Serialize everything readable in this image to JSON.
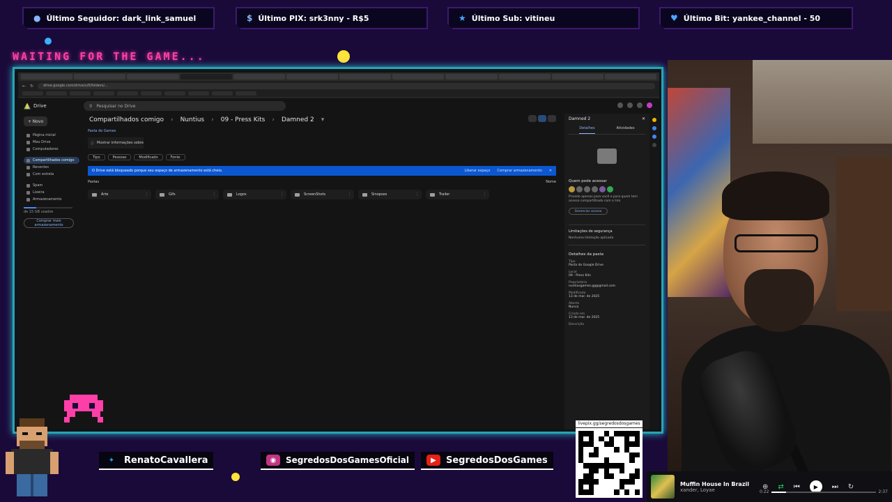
{
  "overlay": {
    "alerts": [
      {
        "icon": "user-icon",
        "text": "Último Seguidor: dark_link_samuel"
      },
      {
        "icon": "dollar-icon",
        "text": "Último PIX: srk3nny - R$5"
      },
      {
        "icon": "star-icon",
        "text": "Último Sub: vitineu"
      },
      {
        "icon": "heart-icon",
        "text": "Último Bit: yankee_channel - 50"
      }
    ],
    "waiting_text": "WAITING FOR THE GAME...",
    "social": [
      {
        "icon": "twitter-icon",
        "handle": "RenatoCavallera",
        "color": "#1da1f2"
      },
      {
        "icon": "instagram-icon",
        "handle": "SegredosDosGamesOficial",
        "color": "#c13584"
      },
      {
        "icon": "youtube-icon",
        "handle": "SegredosDosGames",
        "color": "#e62117"
      }
    ],
    "qr_label": "livepix.gg/segredosdosgames",
    "colors": {
      "frame": "#26a5b4",
      "accent_pink": "#ff3fa8",
      "background": "#1a0a3a"
    }
  },
  "browser": {
    "url": "drive.google.com/drive/u/0/folders/...",
    "drive": {
      "logo_label": "Drive",
      "search_placeholder": "Pesquisar no Drive",
      "new_button": "Novo",
      "sidebar": [
        {
          "label": "Página inicial",
          "active": false
        },
        {
          "label": "Meu Drive",
          "active": false
        },
        {
          "label": "Computadores",
          "active": false
        },
        {
          "label": "Compartilhados comigo",
          "active": true
        },
        {
          "label": "Recentes",
          "active": false
        },
        {
          "label": "Com estrela",
          "active": false
        },
        {
          "label": "Spam",
          "active": false
        },
        {
          "label": "Lixeira",
          "active": false
        },
        {
          "label": "Armazenamento",
          "active": false
        }
      ],
      "storage_text": "de 15 GB usados",
      "storage_fraction": 0.25,
      "buy_storage": "Comprar mais armazenamento",
      "breadcrumb": [
        "Compartilhados comigo",
        "Nuntius",
        "09 - Press Kits",
        "Damned 2"
      ],
      "parent_link": "Pasta do Games",
      "info_card": "Mostrar informações sobre",
      "filters": [
        "Tipo",
        "Pessoas",
        "Modificado",
        "Fonte"
      ],
      "banner_text": "O Drive está bloqueado porque seu espaço de armazenamento está cheio.",
      "banner_actions": [
        "Liberar espaço",
        "Comprar armazenamento"
      ],
      "folders_heading": "Pastas",
      "sort_label": "Nome",
      "folders": [
        "Arte",
        "Gifs",
        "Logos",
        "ScreenShots",
        "Sinopses",
        "Trailer"
      ]
    },
    "details": {
      "title": "Damned 2",
      "tabs": [
        "Detalhes",
        "Atividades"
      ],
      "who_access": "Quem pode acessar",
      "access_text": "Privado apenas para você e para quem tem acesso compartilhado com o link.",
      "manage_button": "Gerenciar acesso",
      "security_title": "Limitações de segurança",
      "security_text": "Nenhuma limitação aplicada",
      "folder_details": "Detalhes da pasta",
      "fields": [
        {
          "k": "Tipo",
          "v": "Pasta do Google Drive"
        },
        {
          "k": "Local",
          "v": "09 - Press Kits"
        },
        {
          "k": "Proprietário",
          "v": "nuntiusgames.gg@gmail.com"
        },
        {
          "k": "Modificado",
          "v": "13 de mar. de 2025"
        },
        {
          "k": "Aberto",
          "v": "Nunca"
        },
        {
          "k": "Criado em",
          "v": "13 de mar. de 2025"
        },
        {
          "k": "Descrição",
          "v": ""
        }
      ]
    }
  },
  "music": {
    "title": "Muffin House In Brazil",
    "artist": "xander, Loyae",
    "elapsed": "0:22",
    "duration": "2:37",
    "progress": 0.14
  }
}
